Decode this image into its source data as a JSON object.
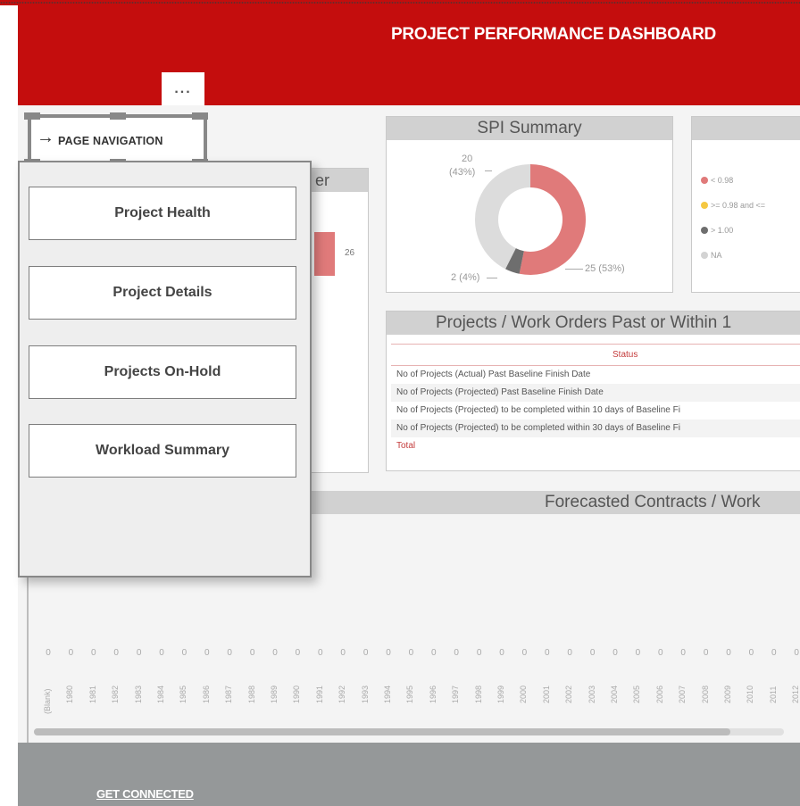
{
  "header": {
    "title": "PROJECT PERFORMANCE DASHBOARD",
    "more_label": "..."
  },
  "navigation": {
    "toggle_label": "PAGE NAVIGATION",
    "items": [
      {
        "label": "Project Health"
      },
      {
        "label": "Project Details"
      },
      {
        "label": "Projects On-Hold"
      },
      {
        "label": "Workload Summary"
      }
    ]
  },
  "left_card": {
    "title_fragment": "er",
    "bar_value_label": "26"
  },
  "spi_summary": {
    "title": "SPI Summary",
    "labels": [
      "20",
      "(43%)",
      "25 (53%)",
      "2 (4%)"
    ],
    "colors": {
      "red": "#e07a7a",
      "dark": "#6e6e6e",
      "light": "#dcdcdc"
    },
    "chart_data": {
      "type": "pie",
      "slices": [
        {
          "label": "< 0.98",
          "value": 25,
          "percent": 53
        },
        {
          "label": "> 1.00",
          "value": 2,
          "percent": 4
        },
        {
          "label": "NA",
          "value": 20,
          "percent": 43
        }
      ]
    }
  },
  "legend": {
    "items": [
      {
        "label": "< 0.98",
        "color": "#e07a7a"
      },
      {
        "label": ">= 0.98 and <=",
        "color": "#f5c842"
      },
      {
        "label": "> 1.00",
        "color": "#6e6e6e"
      },
      {
        "label": "NA",
        "color": "#d3d3d3"
      }
    ]
  },
  "orders": {
    "title": "Projects / Work Orders Past or Within 1",
    "column_header": "Status",
    "rows": [
      "No of Projects (Actual) Past Baseline Finish Date",
      "No of Projects (Projected) Past Baseline Finish Date",
      "No of Projects (Projected) to be completed within 10 days of Baseline Fi",
      "No of Projects (Projected) to be completed within 30 days of Baseline Fi",
      "Total"
    ]
  },
  "forecast": {
    "title": "Forecasted Contracts / Work",
    "chart_data": {
      "type": "bar",
      "categories": [
        "(Blank)",
        "1980",
        "1981",
        "1982",
        "1983",
        "1984",
        "1985",
        "1986",
        "1987",
        "1988",
        "1989",
        "1990",
        "1991",
        "1992",
        "1993",
        "1994",
        "1995",
        "1996",
        "1997",
        "1998",
        "1999",
        "2000",
        "2001",
        "2002",
        "2003",
        "2004",
        "2005",
        "2006",
        "2007",
        "2008",
        "2009",
        "2010",
        "2011",
        "2012"
      ],
      "values": [
        0,
        0,
        0,
        0,
        0,
        0,
        0,
        0,
        0,
        0,
        0,
        0,
        0,
        0,
        0,
        0,
        0,
        0,
        0,
        0,
        0,
        0,
        0,
        0,
        0,
        0,
        0,
        0,
        0,
        0,
        0,
        0,
        0,
        0
      ]
    }
  },
  "footer": {
    "link_label": "GET CONNECTED"
  }
}
